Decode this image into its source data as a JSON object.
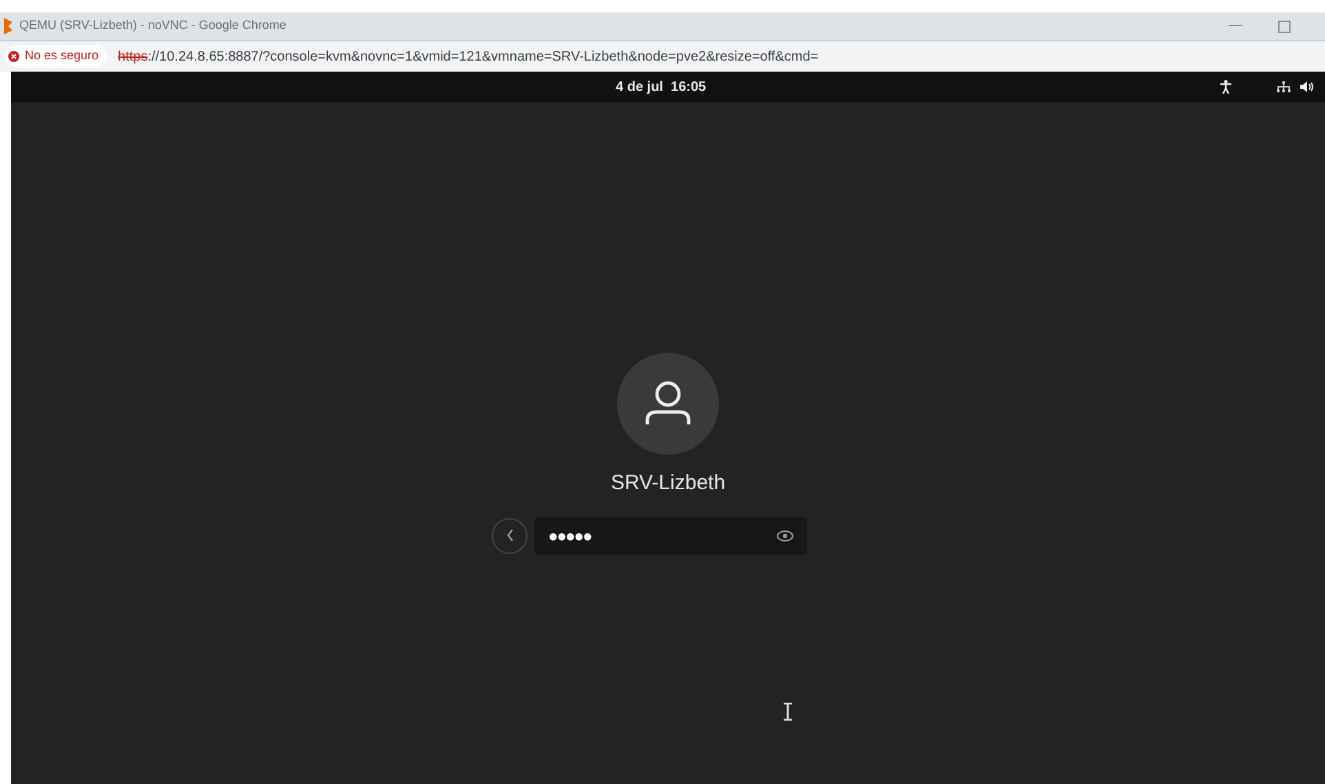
{
  "window": {
    "title": "QEMU (SRV-Lizbeth) - noVNC - Google Chrome"
  },
  "address_bar": {
    "security": "No es seguro",
    "scheme": "https",
    "url": "://10.24.8.65:8887/?console=kvm&novnc=1&vmid=121&vmname=SRV-Lizbeth&node=pve2&resize=off&cmd="
  },
  "top_bar": {
    "clock": "4 de jul  16:05"
  },
  "login": {
    "username": "SRV-Lizbeth",
    "password": "●●●●●"
  }
}
